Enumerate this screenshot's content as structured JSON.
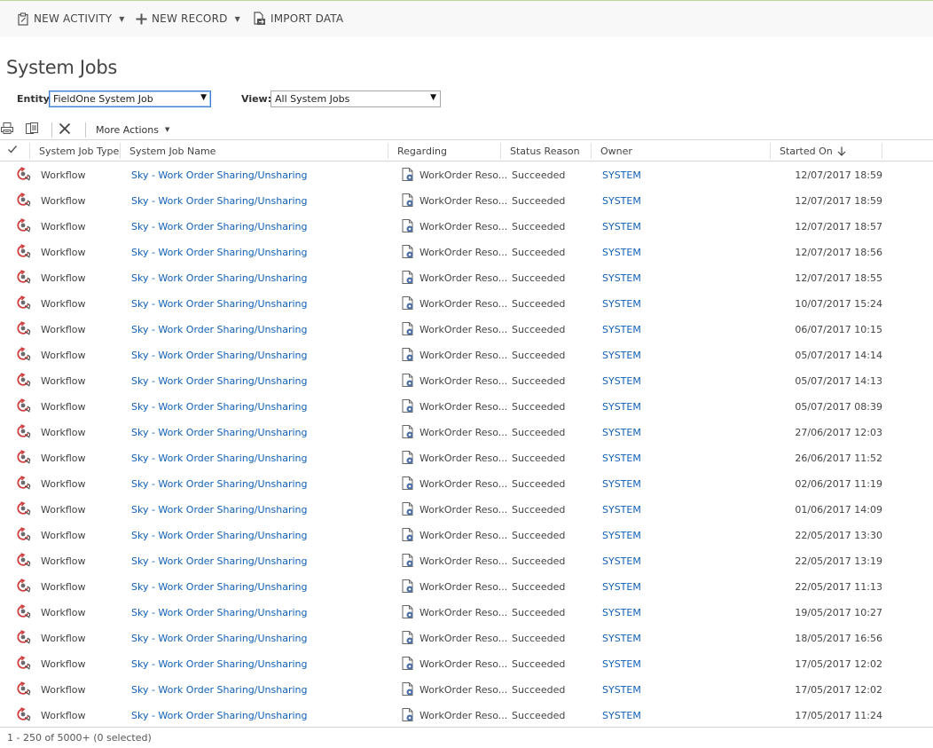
{
  "command_bar": {
    "new_activity": "NEW ACTIVITY",
    "new_record": "NEW RECORD",
    "import_data": "IMPORT DATA"
  },
  "page_title": "System Jobs",
  "filters": {
    "entity_label": "Entity:",
    "entity_value": "FieldOne System Job",
    "view_label": "View:",
    "view_value": "All System Jobs"
  },
  "grid_toolbar": {
    "more_actions": "More Actions"
  },
  "grid": {
    "columns": [
      "System Job Type",
      "System Job Name",
      "Regarding",
      "Status Reason",
      "Owner",
      "Started On"
    ],
    "sort_column": "Started On",
    "sort_direction": "descending",
    "rows": [
      {
        "type": "Workflow",
        "name": "Sky - Work Order Sharing/Unsharing",
        "regarding": "WorkOrder Reso...",
        "status": "Succeeded",
        "owner": "SYSTEM",
        "started": "12/07/2017 18:59"
      },
      {
        "type": "Workflow",
        "name": "Sky - Work Order Sharing/Unsharing",
        "regarding": "WorkOrder Reso...",
        "status": "Succeeded",
        "owner": "SYSTEM",
        "started": "12/07/2017 18:59"
      },
      {
        "type": "Workflow",
        "name": "Sky - Work Order Sharing/Unsharing",
        "regarding": "WorkOrder Reso...",
        "status": "Succeeded",
        "owner": "SYSTEM",
        "started": "12/07/2017 18:57"
      },
      {
        "type": "Workflow",
        "name": "Sky - Work Order Sharing/Unsharing",
        "regarding": "WorkOrder Reso...",
        "status": "Succeeded",
        "owner": "SYSTEM",
        "started": "12/07/2017 18:56"
      },
      {
        "type": "Workflow",
        "name": "Sky - Work Order Sharing/Unsharing",
        "regarding": "WorkOrder Reso...",
        "status": "Succeeded",
        "owner": "SYSTEM",
        "started": "12/07/2017 18:55"
      },
      {
        "type": "Workflow",
        "name": "Sky - Work Order Sharing/Unsharing",
        "regarding": "WorkOrder Reso...",
        "status": "Succeeded",
        "owner": "SYSTEM",
        "started": "10/07/2017 15:24"
      },
      {
        "type": "Workflow",
        "name": "Sky - Work Order Sharing/Unsharing",
        "regarding": "WorkOrder Reso...",
        "status": "Succeeded",
        "owner": "SYSTEM",
        "started": "06/07/2017 10:15"
      },
      {
        "type": "Workflow",
        "name": "Sky - Work Order Sharing/Unsharing",
        "regarding": "WorkOrder Reso...",
        "status": "Succeeded",
        "owner": "SYSTEM",
        "started": "05/07/2017 14:14"
      },
      {
        "type": "Workflow",
        "name": "Sky - Work Order Sharing/Unsharing",
        "regarding": "WorkOrder Reso...",
        "status": "Succeeded",
        "owner": "SYSTEM",
        "started": "05/07/2017 14:13"
      },
      {
        "type": "Workflow",
        "name": "Sky - Work Order Sharing/Unsharing",
        "regarding": "WorkOrder Reso...",
        "status": "Succeeded",
        "owner": "SYSTEM",
        "started": "05/07/2017 08:39"
      },
      {
        "type": "Workflow",
        "name": "Sky - Work Order Sharing/Unsharing",
        "regarding": "WorkOrder Reso...",
        "status": "Succeeded",
        "owner": "SYSTEM",
        "started": "27/06/2017 12:03"
      },
      {
        "type": "Workflow",
        "name": "Sky - Work Order Sharing/Unsharing",
        "regarding": "WorkOrder Reso...",
        "status": "Succeeded",
        "owner": "SYSTEM",
        "started": "26/06/2017 11:52"
      },
      {
        "type": "Workflow",
        "name": "Sky - Work Order Sharing/Unsharing",
        "regarding": "WorkOrder Reso...",
        "status": "Succeeded",
        "owner": "SYSTEM",
        "started": "02/06/2017 11:19"
      },
      {
        "type": "Workflow",
        "name": "Sky - Work Order Sharing/Unsharing",
        "regarding": "WorkOrder Reso...",
        "status": "Succeeded",
        "owner": "SYSTEM",
        "started": "01/06/2017 14:09"
      },
      {
        "type": "Workflow",
        "name": "Sky - Work Order Sharing/Unsharing",
        "regarding": "WorkOrder Reso...",
        "status": "Succeeded",
        "owner": "SYSTEM",
        "started": "22/05/2017 13:30"
      },
      {
        "type": "Workflow",
        "name": "Sky - Work Order Sharing/Unsharing",
        "regarding": "WorkOrder Reso...",
        "status": "Succeeded",
        "owner": "SYSTEM",
        "started": "22/05/2017 13:19"
      },
      {
        "type": "Workflow",
        "name": "Sky - Work Order Sharing/Unsharing",
        "regarding": "WorkOrder Reso...",
        "status": "Succeeded",
        "owner": "SYSTEM",
        "started": "22/05/2017 11:13"
      },
      {
        "type": "Workflow",
        "name": "Sky - Work Order Sharing/Unsharing",
        "regarding": "WorkOrder Reso...",
        "status": "Succeeded",
        "owner": "SYSTEM",
        "started": "19/05/2017 10:27"
      },
      {
        "type": "Workflow",
        "name": "Sky - Work Order Sharing/Unsharing",
        "regarding": "WorkOrder Reso...",
        "status": "Succeeded",
        "owner": "SYSTEM",
        "started": "18/05/2017 16:56"
      },
      {
        "type": "Workflow",
        "name": "Sky - Work Order Sharing/Unsharing",
        "regarding": "WorkOrder Reso...",
        "status": "Succeeded",
        "owner": "SYSTEM",
        "started": "17/05/2017 12:02"
      },
      {
        "type": "Workflow",
        "name": "Sky - Work Order Sharing/Unsharing",
        "regarding": "WorkOrder Reso...",
        "status": "Succeeded",
        "owner": "SYSTEM",
        "started": "17/05/2017 12:02"
      },
      {
        "type": "Workflow",
        "name": "Sky - Work Order Sharing/Unsharing",
        "regarding": "WorkOrder Reso...",
        "status": "Succeeded",
        "owner": "SYSTEM",
        "started": "17/05/2017 11:24"
      }
    ]
  },
  "footer": {
    "status": "1 - 250 of 5000+ (0 selected)"
  },
  "colors": {
    "link": "#1160b7",
    "command_bar_bg": "#f8f8f8",
    "accent_line": "#c3d69b"
  }
}
